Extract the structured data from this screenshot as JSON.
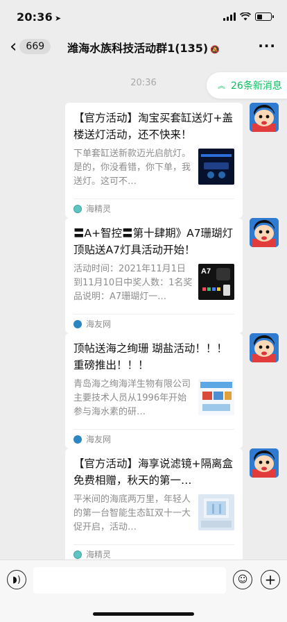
{
  "status_bar": {
    "time": "20:36",
    "battery_level": 0.4
  },
  "nav": {
    "unread_count": "669",
    "title": "潍海水族科技活动群1(135)"
  },
  "timestamp": "20:36",
  "new_messages": "26条新消息",
  "messages": [
    {
      "title": "【官方活动】淘宝买套缸送灯+盖楼送灯活动，还不快来！",
      "desc": "下单套缸送新款迈光启航灯。是的，你没看错，你下单，我送灯。这可不…",
      "source": "海精灵"
    },
    {
      "title": "〓A+智控〓第十肆期》A7珊瑚灯顶贴送A7灯具活动开始！",
      "desc": "活动时间：2021年11月1日到11月10日中奖人数：1名奖品说明：A7珊瑚灯一…",
      "source": "海友网"
    },
    {
      "title": "顶帖送海之绚珊 瑚盐活动！！！ 重磅推出！！！",
      "desc": "青岛海之绚海洋生物有限公司主要技术人员从1996年开始参与海水素的研…",
      "source": "海友网"
    },
    {
      "title": "【官方活动】海享说滤镜+隔离盒免费相赠，秋天的第一…",
      "desc": "平米间的海底两万里，年轻人的第一台智能生态缸双十一大促开启，活动…",
      "source": "海精灵"
    }
  ],
  "input": {
    "value": ""
  },
  "icons": {
    "back": "chevron-left-icon",
    "more": "more-dots-icon",
    "voice": "voice-icon",
    "emoji": "emoji-icon",
    "plus": "plus-icon"
  }
}
